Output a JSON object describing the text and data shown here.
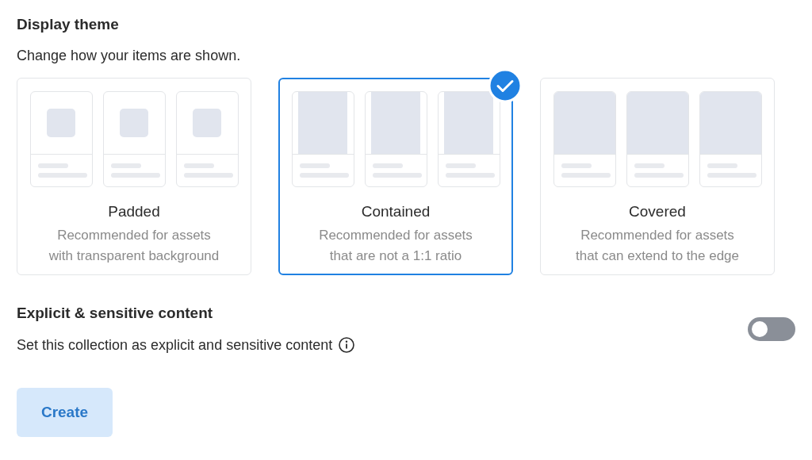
{
  "section_title": "Display theme",
  "section_subtitle": "Change how your items are shown.",
  "themes": [
    {
      "kind": "padded",
      "title": "Padded",
      "description": [
        "Recommended for assets",
        "with transparent background"
      ],
      "selected": false
    },
    {
      "kind": "contained",
      "title": "Contained",
      "description": [
        "Recommended for assets",
        "that are not a 1:1 ratio"
      ],
      "selected": true
    },
    {
      "kind": "covered",
      "title": "Covered",
      "description": [
        "Recommended for assets",
        "that can extend to the edge"
      ],
      "selected": false
    }
  ],
  "explicit": {
    "title": "Explicit & sensitive content",
    "description": "Set this collection as explicit and sensitive content",
    "on": false
  },
  "create_button": {
    "label": "Create",
    "disabled": true
  }
}
